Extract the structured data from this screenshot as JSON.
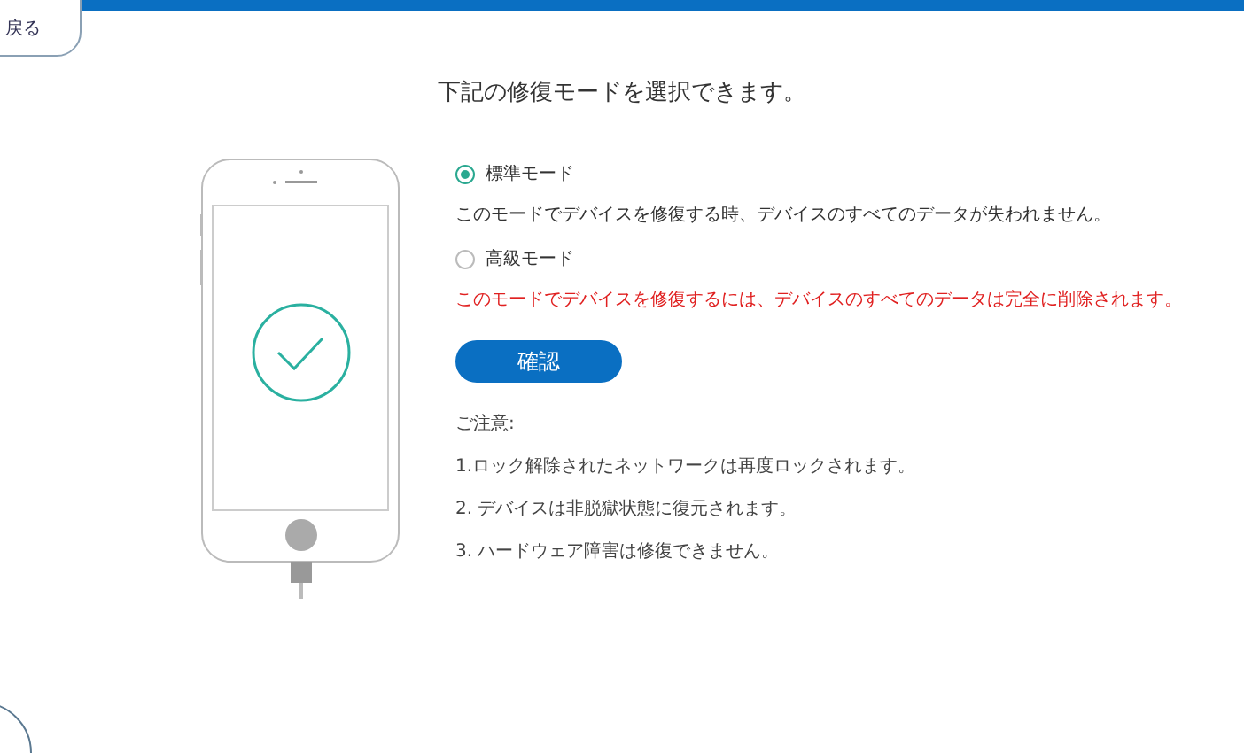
{
  "back_button": {
    "label": "戻る"
  },
  "title": "下記の修復モードを選択できます。",
  "modes": [
    {
      "label": "標準モード",
      "selected": true,
      "description": "このモードでデバイスを修復する時、デバイスのすべてのデータが失われません。",
      "kind": "info"
    },
    {
      "label": "高級モード",
      "selected": false,
      "description": "このモードでデバイスを修復するには、デバイスのすべてのデータは完全に削除されます。",
      "kind": "warning"
    }
  ],
  "confirm_button": {
    "label": "確認"
  },
  "notes": {
    "heading": "ご注意:",
    "items": [
      "1.ロック解除されたネットワークは再度ロックされます。",
      "2. デバイスは非脱獄状態に復元されます。",
      "3. ハードウェア障害は修復できません。"
    ]
  }
}
